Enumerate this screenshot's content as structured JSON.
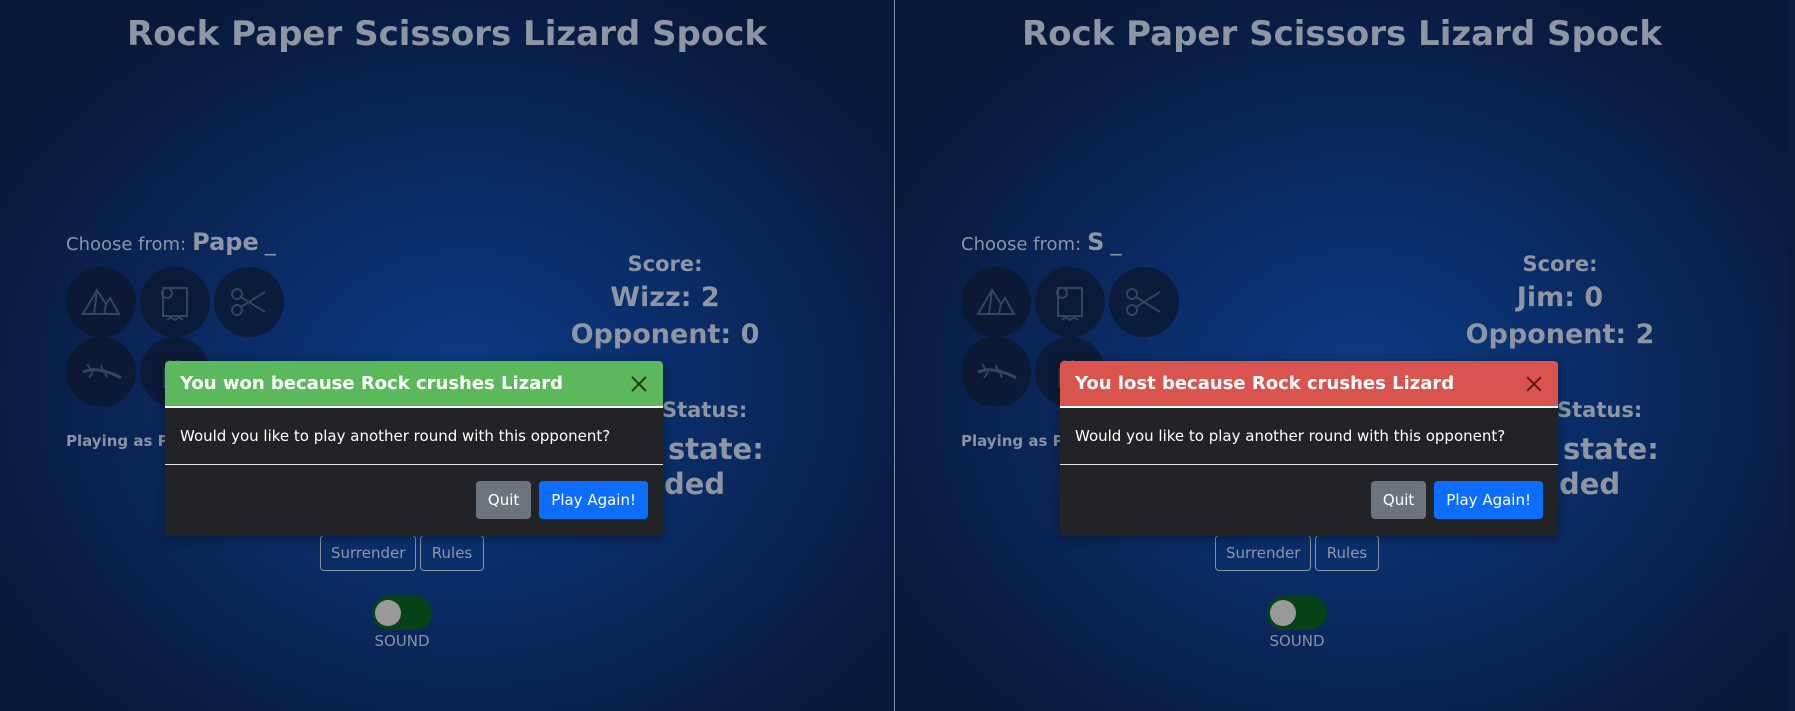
{
  "colors": {
    "win_header": "#5cb85c",
    "lose_header": "#d9534f",
    "play_again_button": "#0d6efd",
    "quit_button": "#6c757d",
    "modal_background": "#212327",
    "sound_toggle": "#064315"
  },
  "icons": [
    "rock-icon",
    "paper-icon",
    "scissors-icon",
    "lizard-icon",
    "spock-icon",
    "close-icon"
  ],
  "left": {
    "title": "Rock Paper Scissors Lizard Spock",
    "choose_label": "Choose from:",
    "typed_text": "Pape",
    "caret": "_",
    "playing_as": "Playing as Pla",
    "score": {
      "label": "Score:",
      "player_line": "Wizz: 2",
      "opponent_line": "Opponent: 0"
    },
    "status_label": "Status:",
    "state_text": "state:",
    "ended_text": "ded",
    "surrender_label": "Surrender",
    "rules_label": "Rules",
    "sound_label": "SOUND",
    "modal": {
      "title": "You won because Rock crushes Lizard",
      "body": "Would you like to play another round with this opponent?",
      "quit_label": "Quit",
      "play_again_label": "Play Again!"
    }
  },
  "right": {
    "title": "Rock Paper Scissors Lizard Spock",
    "choose_label": "Choose from:",
    "typed_text": "S",
    "caret": "_",
    "playing_as": "Playing as Pla",
    "score": {
      "label": "Score:",
      "player_line": "Jim: 0",
      "opponent_line": "Opponent: 2"
    },
    "status_label": "Status:",
    "state_text": "state:",
    "ended_text": "ded",
    "surrender_label": "Surrender",
    "rules_label": "Rules",
    "sound_label": "SOUND",
    "modal": {
      "title": "You lost because Rock crushes Lizard",
      "body": "Would you like to play another round with this opponent?",
      "quit_label": "Quit",
      "play_again_label": "Play Again!"
    }
  }
}
